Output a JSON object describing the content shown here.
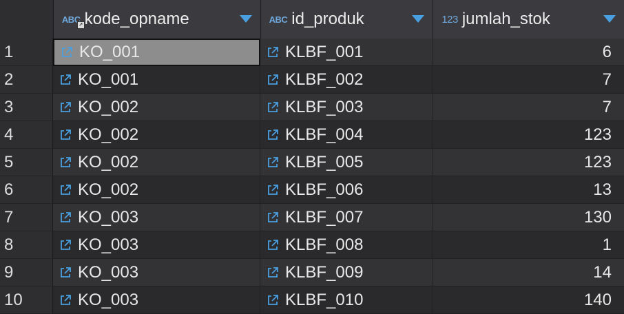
{
  "header": {
    "columns": [
      {
        "type": "ABC",
        "label": "kode_opname"
      },
      {
        "type": "ABC",
        "label": "id_produk"
      },
      {
        "type": "123",
        "label": "jumlah_stok"
      }
    ]
  },
  "rows": [
    {
      "num": "1",
      "kode_opname": "KO_001",
      "id_produk": "KLBF_001",
      "jumlah_stok": "6"
    },
    {
      "num": "2",
      "kode_opname": "KO_001",
      "id_produk": "KLBF_002",
      "jumlah_stok": "7"
    },
    {
      "num": "3",
      "kode_opname": "KO_002",
      "id_produk": "KLBF_003",
      "jumlah_stok": "7"
    },
    {
      "num": "4",
      "kode_opname": "KO_002",
      "id_produk": "KLBF_004",
      "jumlah_stok": "123"
    },
    {
      "num": "5",
      "kode_opname": "KO_002",
      "id_produk": "KLBF_005",
      "jumlah_stok": "123"
    },
    {
      "num": "6",
      "kode_opname": "KO_002",
      "id_produk": "KLBF_006",
      "jumlah_stok": "13"
    },
    {
      "num": "7",
      "kode_opname": "KO_003",
      "id_produk": "KLBF_007",
      "jumlah_stok": "130"
    },
    {
      "num": "8",
      "kode_opname": "KO_003",
      "id_produk": "KLBF_008",
      "jumlah_stok": "1"
    },
    {
      "num": "9",
      "kode_opname": "KO_003",
      "id_produk": "KLBF_009",
      "jumlah_stok": "14"
    },
    {
      "num": "10",
      "kode_opname": "KO_003",
      "id_produk": "KLBF_010",
      "jumlah_stok": "140"
    }
  ],
  "colors": {
    "accent": "#4a9fe0",
    "selected_cell": "#8d8d8d"
  }
}
